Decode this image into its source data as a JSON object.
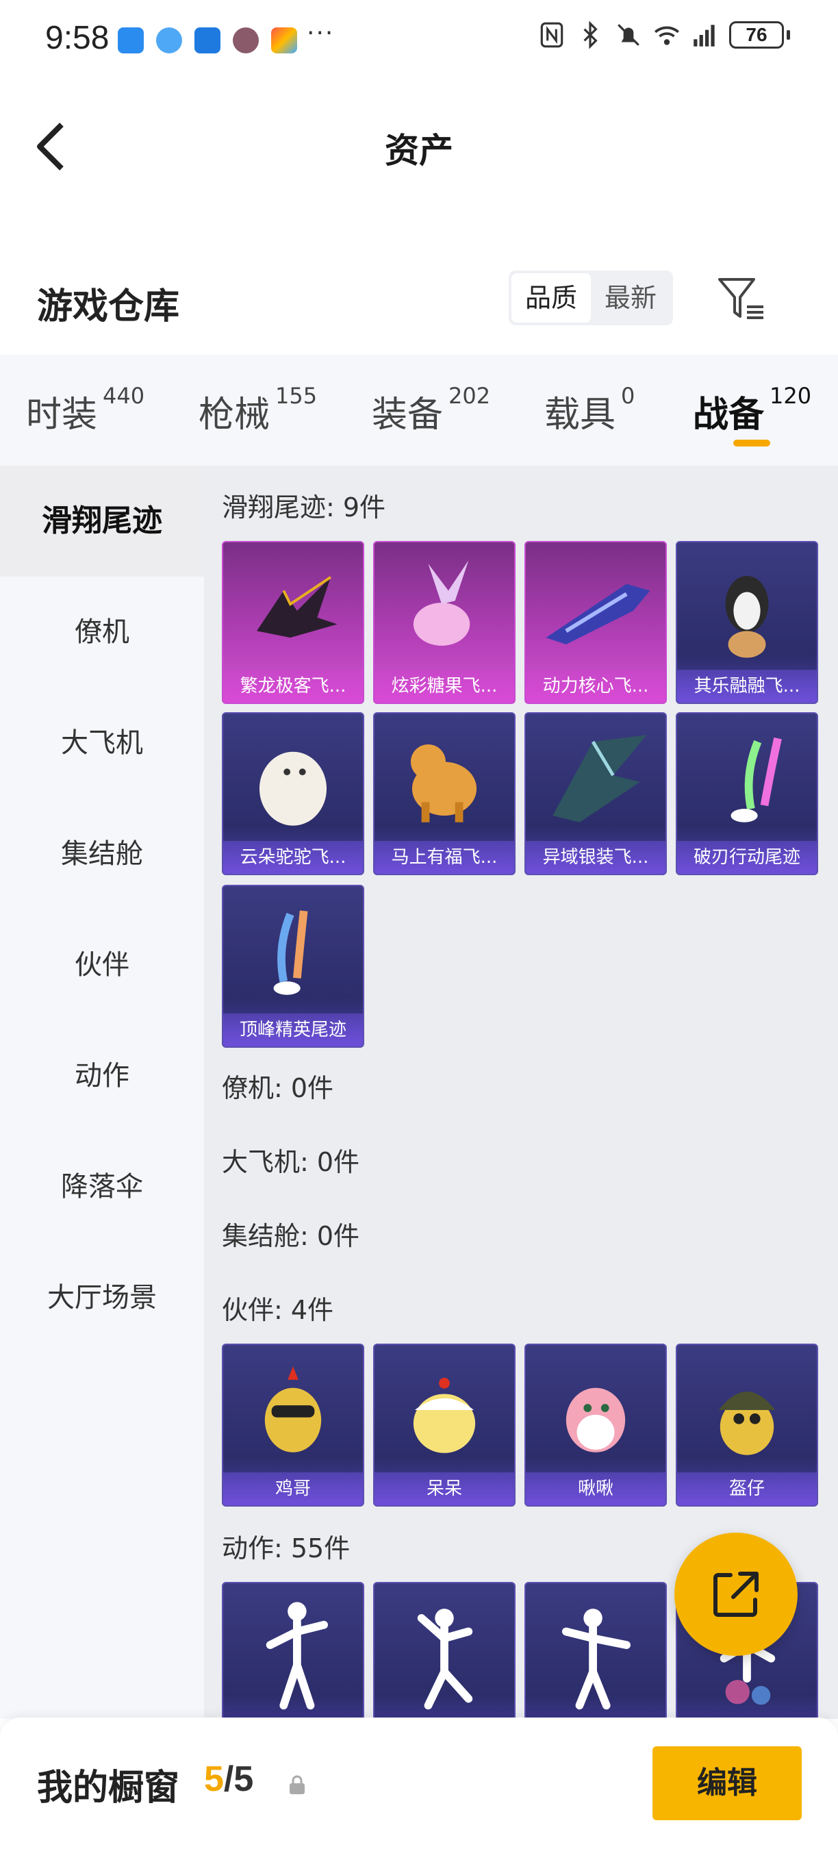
{
  "status_bar": {
    "time": "9:58",
    "more": "···",
    "battery": "76",
    "icons": [
      "message-app-icon",
      "browser-app-icon",
      "app-icon",
      "game-app-icon",
      "app-icon",
      "nfc-icon",
      "bluetooth-icon",
      "mute-icon",
      "wifi-icon",
      "signal-icon",
      "battery-icon"
    ]
  },
  "header": {
    "title": "资产",
    "back_icon": "chevron-left-icon"
  },
  "warehouse": {
    "title": "游戏仓库",
    "sort_options": [
      "品质",
      "最新"
    ],
    "active_sort": "品质",
    "filter_icon": "filter-icon"
  },
  "tabs": [
    {
      "label": "时装",
      "count": "440"
    },
    {
      "label": "枪械",
      "count": "155"
    },
    {
      "label": "装备",
      "count": "202"
    },
    {
      "label": "载具",
      "count": "0"
    },
    {
      "label": "战备",
      "count": "120"
    }
  ],
  "active_tab": "战备",
  "side_nav": [
    {
      "label": "滑翔尾迹"
    },
    {
      "label": "僚机"
    },
    {
      "label": "大飞机"
    },
    {
      "label": "集结舱"
    },
    {
      "label": "伙伴"
    },
    {
      "label": "动作"
    },
    {
      "label": "降落伞"
    },
    {
      "label": "大厅场景"
    }
  ],
  "sections": {
    "glide_trail": {
      "title": "滑翔尾迹: 9件",
      "items": [
        {
          "name": "繁龙极客飞...",
          "rarity": "legendary"
        },
        {
          "name": "炫彩糖果飞...",
          "rarity": "legendary"
        },
        {
          "name": "动力核心飞...",
          "rarity": "legendary"
        },
        {
          "name": "其乐融融飞...",
          "rarity": "epic"
        },
        {
          "name": "云朵驼驼飞...",
          "rarity": "epic"
        },
        {
          "name": "马上有福飞...",
          "rarity": "epic"
        },
        {
          "name": "异域银装飞...",
          "rarity": "epic"
        },
        {
          "name": "破刃行动尾迹",
          "rarity": "epic"
        },
        {
          "name": "顶峰精英尾迹",
          "rarity": "epic"
        }
      ]
    },
    "wingman": {
      "title": "僚机: 0件"
    },
    "big_plane": {
      "title": "大飞机: 0件"
    },
    "pod": {
      "title": "集结舱: 0件"
    },
    "companion": {
      "title": "伙伴: 4件",
      "items": [
        {
          "name": "鸡哥"
        },
        {
          "name": "呆呆"
        },
        {
          "name": "啾啾"
        },
        {
          "name": "盔仔"
        }
      ]
    },
    "emote": {
      "title": "动作: 55件"
    }
  },
  "bottom_bar": {
    "title": "我的橱窗",
    "current": "5",
    "separator": "/",
    "total": "5",
    "edit_label": "编辑",
    "lock_icon": "lock-icon",
    "share_icon": "share-icon"
  },
  "colors": {
    "accent": "#f7b500",
    "legendary": "#c84bd0",
    "epic": "#5c4fb0"
  }
}
